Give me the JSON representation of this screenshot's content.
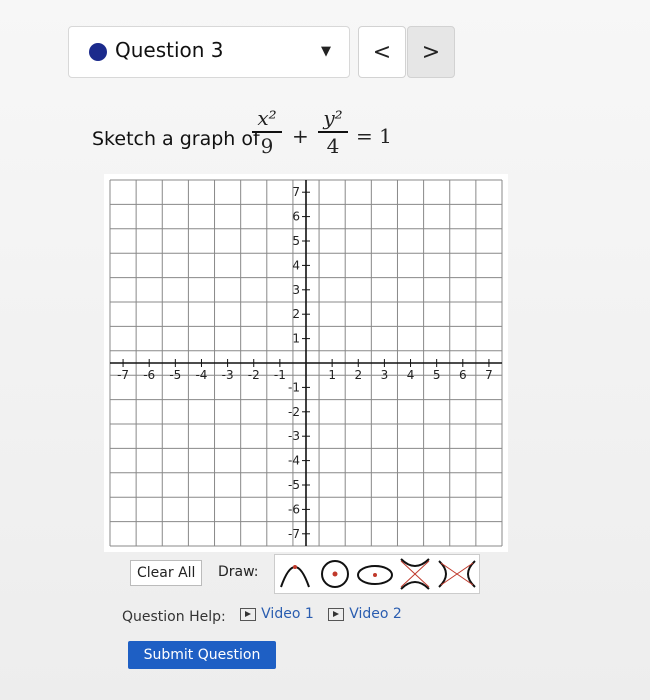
{
  "question": {
    "title": "Question 3",
    "prev_label": "<",
    "next_label": ">"
  },
  "prompt": {
    "text": "Sketch a graph of",
    "term1_num": "x²",
    "term1_den": "9",
    "plus": "+",
    "term2_num": "y²",
    "term2_den": "4",
    "equals": "= 1"
  },
  "graph": {
    "x_min": -7,
    "x_max": 7,
    "y_min": -7,
    "y_max": 7,
    "x_ticks": [
      "-7",
      "-6",
      "-5",
      "-4",
      "-3",
      "-2",
      "-1",
      "1",
      "2",
      "3",
      "4",
      "5",
      "6",
      "7"
    ],
    "y_ticks": [
      "7",
      "6",
      "5",
      "4",
      "3",
      "2",
      "1",
      "-1",
      "-2",
      "-3",
      "-4",
      "-5",
      "-6",
      "-7"
    ],
    "grid": true
  },
  "toolbar": {
    "clear_label": "Clear All",
    "draw_label": "Draw:",
    "tools": [
      "parabola-icon",
      "circle-icon",
      "ellipse-icon",
      "hyperbola-vertical-icon",
      "hyperbola-horizontal-icon"
    ]
  },
  "help": {
    "label": "Question Help:",
    "video1": "Video 1",
    "video2": "Video 2"
  },
  "submit_label": "Submit Question",
  "colors": {
    "accent": "#1e5fc4",
    "dot": "#1b2a8c",
    "tool_red": "#c0392b"
  }
}
